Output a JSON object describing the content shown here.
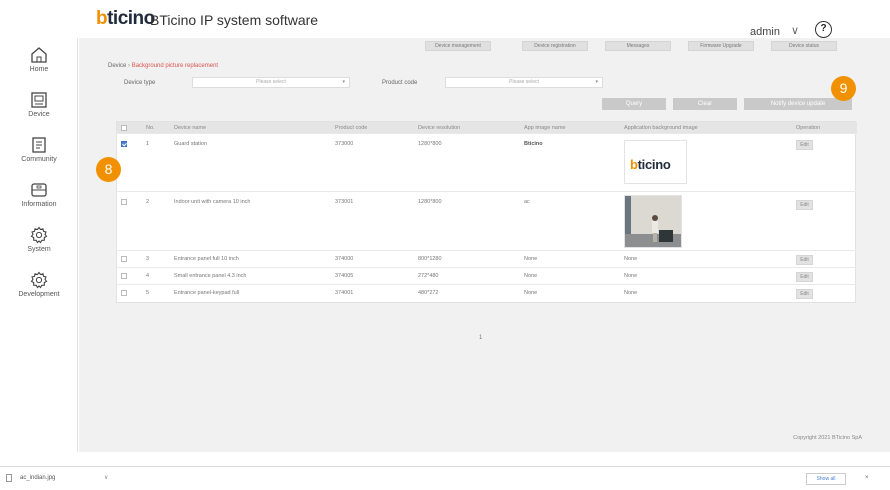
{
  "app": {
    "logo": "bticino",
    "title": "BTicino IP system software",
    "user": "admin",
    "help_symbol": "?"
  },
  "sidebar": {
    "items": [
      {
        "label": "Home",
        "icon": "home-icon"
      },
      {
        "label": "Device",
        "icon": "device-icon"
      },
      {
        "label": "Community",
        "icon": "community-icon"
      },
      {
        "label": "Information",
        "icon": "information-icon"
      },
      {
        "label": "System",
        "icon": "system-gear-icon"
      },
      {
        "label": "Development",
        "icon": "development-gear-icon"
      }
    ]
  },
  "toolbar": {
    "buttons": [
      "Device management",
      "Device registration",
      "Messages",
      "Firmware Upgrade",
      "Device status"
    ]
  },
  "breadcrumb": {
    "root": "Device",
    "current": "Background picture replacement"
  },
  "filters": {
    "device_type_label": "Device type",
    "device_type_placeholder": "Please select",
    "product_code_label": "Product code",
    "product_code_placeholder": "Please select"
  },
  "actions": {
    "query": "Query",
    "clear": "Clear",
    "notify": "Notify device update"
  },
  "table": {
    "columns": [
      "No.",
      "Device name",
      "Product code",
      "Device resolution",
      "App image name",
      "Application background image",
      "Operation"
    ],
    "rows": [
      {
        "no": "1",
        "name": "Guard station",
        "code": "373000",
        "resolution": "1280*800",
        "image_name": "Bticino",
        "background": "bticino logo",
        "checked": true,
        "edit": "Edit"
      },
      {
        "no": "2",
        "name": "Indoor unit with camera 10 inch",
        "code": "373001",
        "resolution": "1280*800",
        "image_name": "ac",
        "background": "photo",
        "checked": false,
        "edit": "Edit"
      },
      {
        "no": "3",
        "name": "Entrance panel full 10 inch",
        "code": "374000",
        "resolution": "800*1280",
        "image_name": "None",
        "background": "None",
        "checked": false,
        "edit": "Edit"
      },
      {
        "no": "4",
        "name": "Small entrance panel 4.3 inch",
        "code": "374005",
        "resolution": "272*480",
        "image_name": "None",
        "background": "None",
        "checked": false,
        "edit": "Edit"
      },
      {
        "no": "5",
        "name": "Entrance panel-keypad full",
        "code": "374001",
        "resolution": "480*272",
        "image_name": "None",
        "background": "None",
        "checked": false,
        "edit": "Edit"
      }
    ]
  },
  "pager": {
    "page": "1"
  },
  "footer": {
    "copyright": "Copyright 2021 BTicino SpA"
  },
  "callouts": {
    "left": "8",
    "right": "9"
  },
  "download_bar": {
    "file_name": "ac_indian.jpg",
    "show_all": "Show all",
    "close": "×"
  },
  "colors": {
    "accent": "#f29100",
    "brand_dark": "#1f2b3a",
    "check_blue": "#4a7fd4"
  }
}
